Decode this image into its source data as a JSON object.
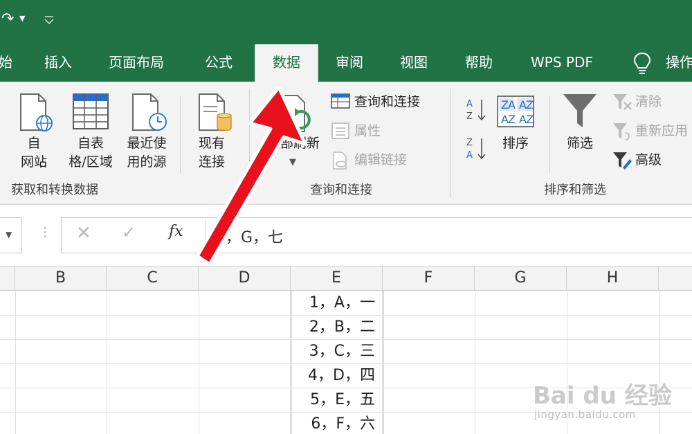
{
  "ribbon_tabs": [
    {
      "label": "始",
      "active": false
    },
    {
      "label": "插入",
      "active": false
    },
    {
      "label": "页面布局",
      "active": false
    },
    {
      "label": "公式",
      "active": false
    },
    {
      "label": "数据",
      "active": true
    },
    {
      "label": "审阅",
      "active": false
    },
    {
      "label": "视图",
      "active": false
    },
    {
      "label": "帮助",
      "active": false
    },
    {
      "label": "WPS PDF",
      "active": false
    },
    {
      "label": "操作",
      "active": false
    }
  ],
  "ribbon": {
    "get_transform": {
      "group_label": "获取和转换数据",
      "from_web": {
        "line1": "自",
        "line2": "网站"
      },
      "from_table": {
        "line1": "自表",
        "line2": "格/区域"
      },
      "recent_sources": {
        "line1": "最近使",
        "line2": "用的源"
      },
      "existing_connections": {
        "line1": "现有",
        "line2": "连接"
      }
    },
    "queries_connections": {
      "group_label": "查询和连接",
      "refresh_all": {
        "label": "全部刷新"
      },
      "queries_and_connections": "查询和连接",
      "properties": "属性",
      "edit_links": "编辑链接"
    },
    "sort_filter": {
      "group_label": "排序和筛选",
      "sort": "排序",
      "filter": "筛选",
      "clear": "清除",
      "reapply": "重新应用",
      "advanced": "高级"
    }
  },
  "formula_bar": {
    "value": "7，G，七",
    "fx": "fx"
  },
  "columns": [
    "B",
    "C",
    "D",
    "E",
    "F",
    "G",
    "H"
  ],
  "column_e_values": [
    "1，A，一",
    "2，B，二",
    "3，C，三",
    "4，D，四",
    "5，E，五",
    "6，F，六"
  ],
  "watermark": {
    "main": "Bai du 经验",
    "sub": "jingyan.baidu.com"
  },
  "colors": {
    "excel_green": "#217346",
    "annotation_arrow": "#e8111c"
  }
}
